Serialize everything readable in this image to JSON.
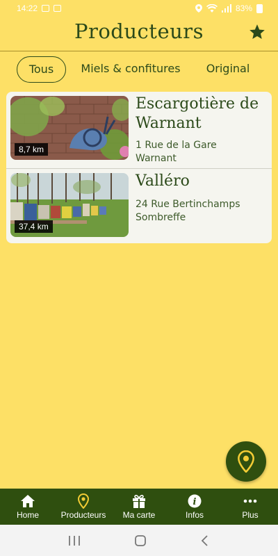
{
  "status_bar": {
    "time": "14:22",
    "battery": "83%"
  },
  "header": {
    "title": "Producteurs"
  },
  "filters": {
    "tabs": [
      {
        "label": "Tous",
        "active": true
      },
      {
        "label": "Miels & confitures",
        "active": false
      },
      {
        "label": "Original",
        "active": false
      }
    ]
  },
  "producers": [
    {
      "name": "Escargotière de Warnant",
      "address_line1": "1 Rue de la Gare",
      "address_line2": "Warnant",
      "distance": "8,7 km"
    },
    {
      "name": "Valléro",
      "address_line1": "24 Rue Bertinchamps",
      "address_line2": "Sombreffe",
      "distance": "37,4 km"
    }
  ],
  "bottom_nav": {
    "items": [
      {
        "label": "Home",
        "icon": "home-icon"
      },
      {
        "label": "Producteurs",
        "icon": "map-pin-icon"
      },
      {
        "label": "Ma carte",
        "icon": "gift-icon"
      },
      {
        "label": "Infos",
        "icon": "info-icon"
      },
      {
        "label": "Plus",
        "icon": "more-icon"
      }
    ]
  },
  "colors": {
    "background": "#fde066",
    "accent": "#2f4f0f",
    "text": "#2c4a1a"
  }
}
